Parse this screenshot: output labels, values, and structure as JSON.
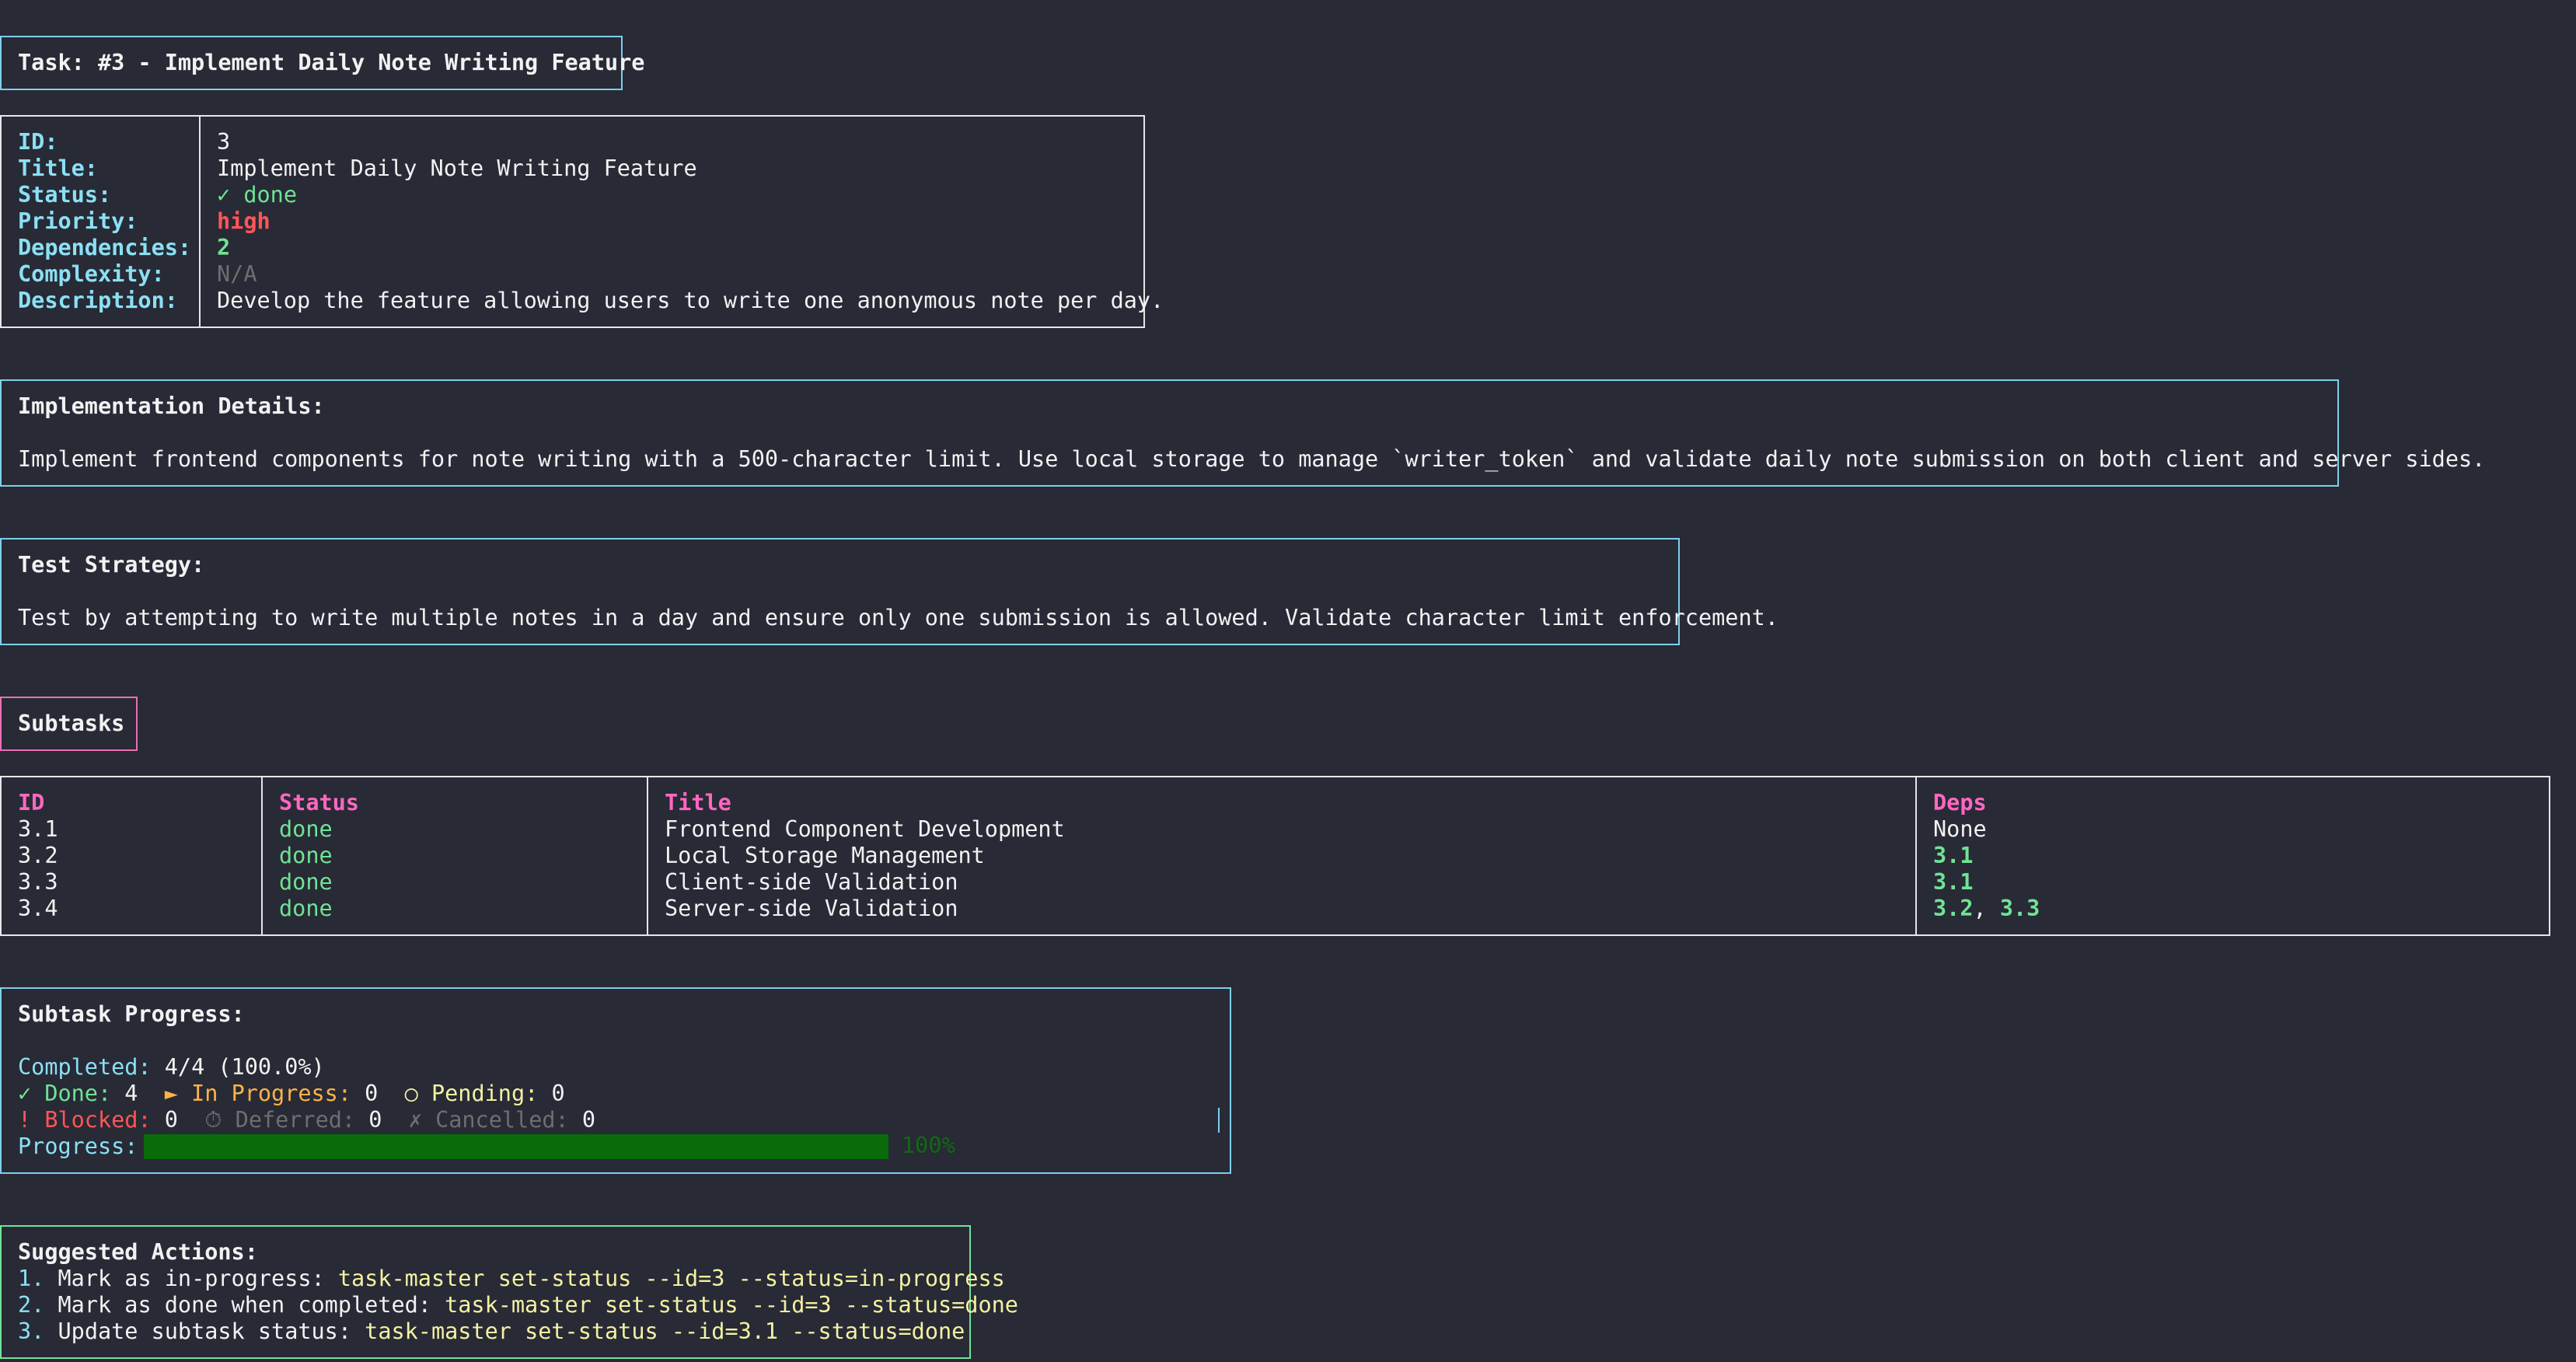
{
  "task_header": {
    "text": "Task: #3 - Implement Daily Note Writing Feature"
  },
  "info": {
    "labels": [
      "ID:",
      "Title:",
      "Status:",
      "Priority:",
      "Dependencies:",
      "Complexity:",
      "Description:"
    ],
    "id": "3",
    "title": "Implement Daily Note Writing Feature",
    "status_icon": "✓",
    "status": "done",
    "priority": "high",
    "dependencies": "2",
    "complexity": "N/A",
    "description": "Develop the feature allowing users to write one anonymous note per day."
  },
  "implementation": {
    "heading": "Implementation Details:",
    "text": "Implement frontend components for note writing with a 500-character limit. Use local storage to manage `writer_token` and validate daily note submission on both client and server sides."
  },
  "test_strategy": {
    "heading": "Test Strategy:",
    "text": "Test by attempting to write multiple notes in a day and ensure only one submission is allowed. Validate character limit enforcement."
  },
  "subtasks_header": {
    "text": "Subtasks"
  },
  "subtasks": {
    "columns": [
      "ID",
      "Status",
      "Title",
      "Deps"
    ],
    "rows": [
      {
        "id": "3.1",
        "status": "done",
        "title": "Frontend Component Development",
        "deps": "None"
      },
      {
        "id": "3.2",
        "status": "done",
        "title": "Local Storage Management",
        "deps": "3.1"
      },
      {
        "id": "3.3",
        "status": "done",
        "title": "Client-side Validation",
        "deps": "3.1"
      },
      {
        "id": "3.4",
        "status": "done",
        "title": "Server-side Validation",
        "deps_a": "3.2",
        "deps_sep": ", ",
        "deps_b": "3.3"
      }
    ]
  },
  "progress": {
    "heading": "Subtask Progress:",
    "completed_label": "Completed:",
    "completed_value": "4/4 (100.0%)",
    "done_label": "✓ Done:",
    "done_value": "4",
    "inprogress_label": "► In Progress:",
    "inprogress_value": "0",
    "pending_label": "○ Pending:",
    "pending_value": "0",
    "blocked_label": "! Blocked:",
    "blocked_value": "0",
    "deferred_label": "⏱ Deferred:",
    "deferred_value": "0",
    "cancelled_label": "✗ Cancelled:",
    "cancelled_value": "0",
    "progress_label": "Progress:",
    "percent": "100%",
    "fraction": 1.0
  },
  "actions": {
    "heading": "Suggested Actions:",
    "items": [
      {
        "num": "1.",
        "text": "Mark as in-progress:",
        "cmd": "task-master set-status --id=3 --status=in-progress"
      },
      {
        "num": "2.",
        "text": "Mark as done when completed:",
        "cmd": "task-master set-status --id=3 --status=done"
      },
      {
        "num": "3.",
        "text": "Update subtask status:",
        "cmd": "task-master set-status --id=3.1 --status=done"
      }
    ]
  },
  "colors": {
    "background": "#282a36",
    "cyan": "#8be0f4",
    "green": "#6fe394",
    "red": "#ff5656",
    "pink": "#ff67c0",
    "yellow": "#f4f1a2",
    "orange": "#ffb347",
    "progress_fill": "#0a6b0a"
  }
}
